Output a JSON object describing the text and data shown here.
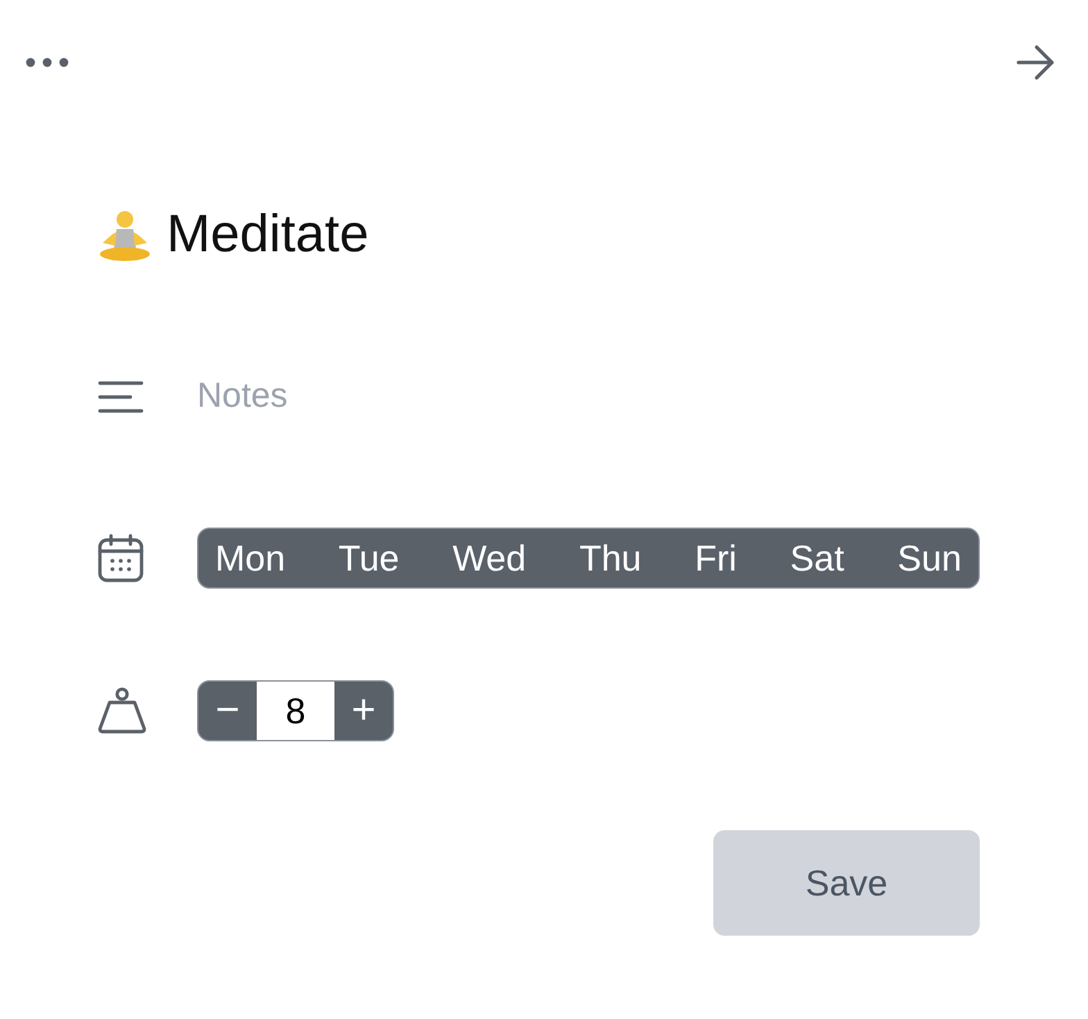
{
  "title": "Meditate",
  "notes": {
    "placeholder": "Notes"
  },
  "days": [
    {
      "label": "Mon",
      "selected": true
    },
    {
      "label": "Tue",
      "selected": true
    },
    {
      "label": "Wed",
      "selected": true
    },
    {
      "label": "Thu",
      "selected": true
    },
    {
      "label": "Fri",
      "selected": true
    },
    {
      "label": "Sat",
      "selected": true
    },
    {
      "label": "Sun",
      "selected": true
    }
  ],
  "stepper": {
    "minus": "−",
    "value": "8",
    "plus": "+"
  },
  "save_button": "Save"
}
